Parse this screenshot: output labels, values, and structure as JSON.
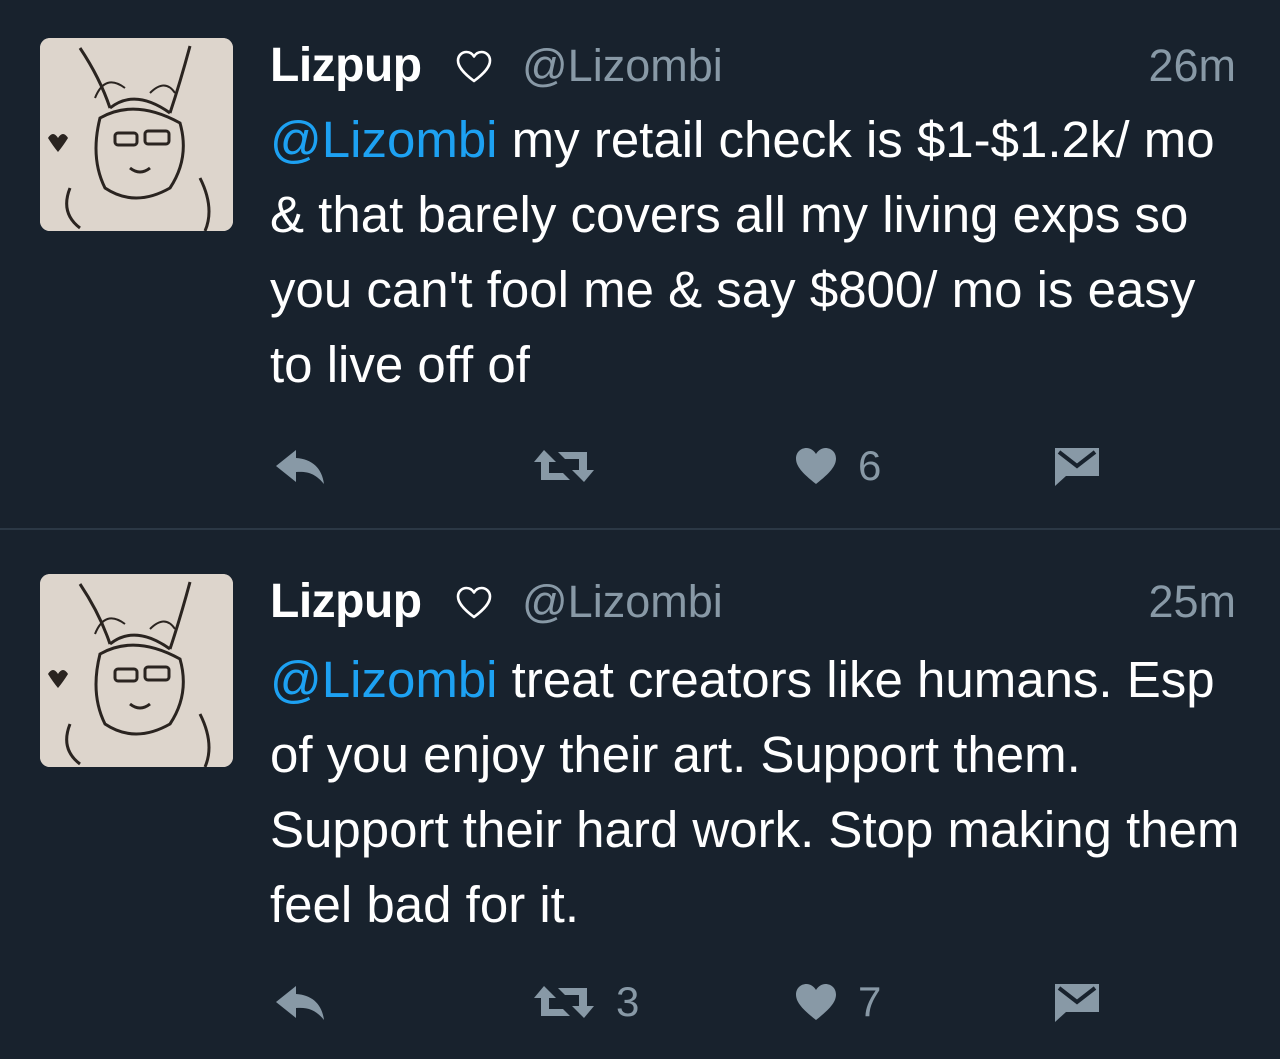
{
  "colors": {
    "background": "#18222d",
    "text": "#ffffff",
    "muted": "#8899a6",
    "mention": "#1da1f2",
    "divider": "#2b3845"
  },
  "tweets": [
    {
      "author_name": "Lizpup",
      "name_badge_icon": "heart-outline-icon",
      "handle": "@Lizombi",
      "timestamp": "26m",
      "mention": "@Lizombi",
      "text": " my retail check is $1-$1.2k/ mo & that barely covers all my living exps so you can't fool me & say $800/ mo is easy to live off of",
      "actions": {
        "reply_icon": "reply-icon",
        "retweet_icon": "retweet-icon",
        "retweet_count": "",
        "like_icon": "heart-icon",
        "like_count": "6",
        "dm_icon": "envelope-icon"
      }
    },
    {
      "author_name": "Lizpup",
      "name_badge_icon": "heart-outline-icon",
      "handle": "@Lizombi",
      "timestamp": "25m",
      "mention": "@Lizombi",
      "text": " treat creators like humans. Esp of you enjoy their art. Support them. Support their hard work. Stop making them feel bad for it.",
      "actions": {
        "reply_icon": "reply-icon",
        "retweet_icon": "retweet-icon",
        "retweet_count": "3",
        "like_icon": "heart-icon",
        "like_count": "7",
        "dm_icon": "envelope-icon"
      }
    }
  ]
}
